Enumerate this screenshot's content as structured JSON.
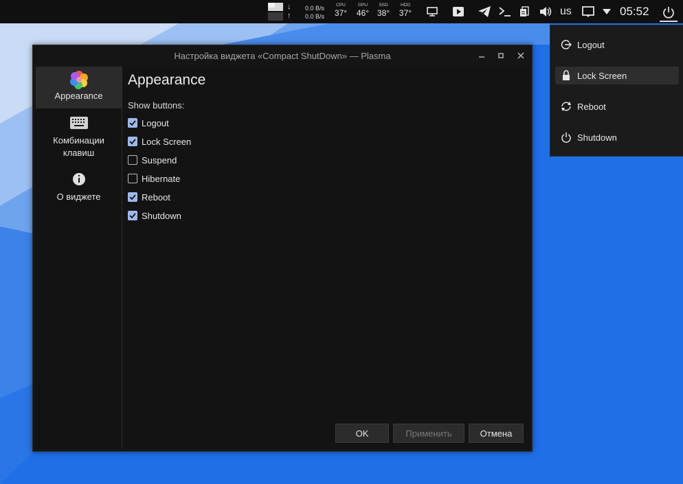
{
  "panel": {
    "net": {
      "down_arrow": "↓",
      "up_arrow": "↑",
      "down_rate": "0.0 B/s",
      "up_rate": "0.0 B/s"
    },
    "sensors": [
      {
        "label": "CPU",
        "value": "37°"
      },
      {
        "label": "GPU",
        "value": "46°"
      },
      {
        "label": "SSD",
        "value": "38°"
      },
      {
        "label": "HDD",
        "value": "37°"
      }
    ],
    "tray_icons": [
      "display-icon",
      "media-play-icon",
      "telegram-icon",
      "terminal-icon",
      "clipboard-icon",
      "volume-icon"
    ],
    "keyboard_layout": "us",
    "clock": "05:52"
  },
  "popup": {
    "items": [
      {
        "label": "Logout",
        "icon": "logout-icon"
      },
      {
        "label": "Lock Screen",
        "icon": "lock-icon",
        "active": true
      },
      {
        "label": "Reboot",
        "icon": "reboot-icon"
      },
      {
        "label": "Shutdown",
        "icon": "shutdown-icon"
      }
    ]
  },
  "window": {
    "title": "Настройка виджета «Compact ShutDown» — Plasma",
    "sidebar": [
      {
        "label": "Appearance",
        "icon": "appearance-icon",
        "active": true
      },
      {
        "label": "Комбинации\nклавиш",
        "icon": "keyboard-icon"
      },
      {
        "label": "О виджете",
        "icon": "info-icon"
      }
    ],
    "content": {
      "title": "Appearance",
      "show_label": "Show buttons:",
      "options": [
        {
          "label": "Logout",
          "checked": true
        },
        {
          "label": "Lock Screen",
          "checked": true
        },
        {
          "label": "Suspend",
          "checked": false
        },
        {
          "label": "Hibernate",
          "checked": false
        },
        {
          "label": "Reboot",
          "checked": true
        },
        {
          "label": "Shutdown",
          "checked": true
        }
      ]
    },
    "buttons": {
      "ok": "OK",
      "apply": "Применить",
      "cancel": "Отмена"
    }
  },
  "colors": {
    "accent": "#9fb8ea",
    "panel": "#101010",
    "wallpaper": "#1e6fe6"
  }
}
